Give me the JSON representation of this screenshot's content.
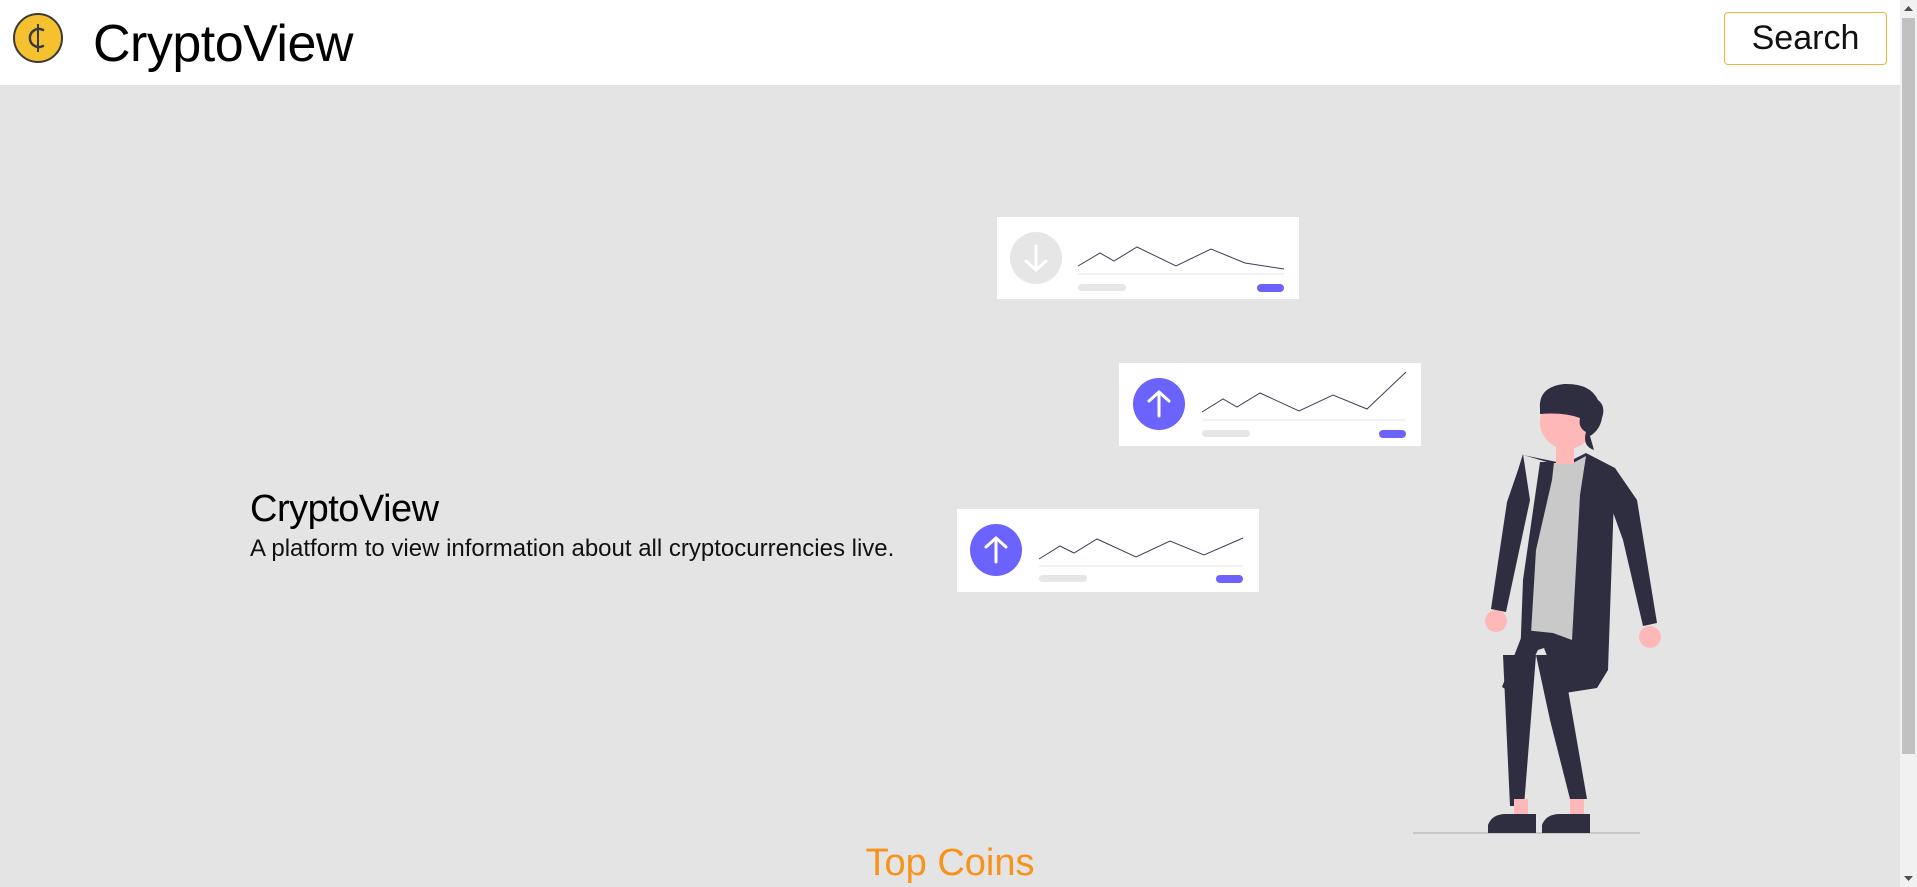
{
  "navbar": {
    "brand": "CryptoView",
    "search_label": "Search",
    "logo_icon": "coin-icon"
  },
  "hero": {
    "title": "CryptoView",
    "subtitle": "A platform to view information about all cryptocurrencies live."
  },
  "illustration": {
    "icon": "person-with-charts-illustration",
    "cards": [
      {
        "icon": "arrow-down-icon",
        "trend": "down"
      },
      {
        "icon": "arrow-up-icon",
        "trend": "up"
      },
      {
        "icon": "arrow-up-icon",
        "trend": "up"
      }
    ]
  },
  "top_coins": {
    "title": "Top Coins"
  },
  "colors": {
    "accent": "#f7931a",
    "coin": "#f5c12e",
    "chart_accent": "#6c63ff",
    "background": "#e4e4e4"
  }
}
